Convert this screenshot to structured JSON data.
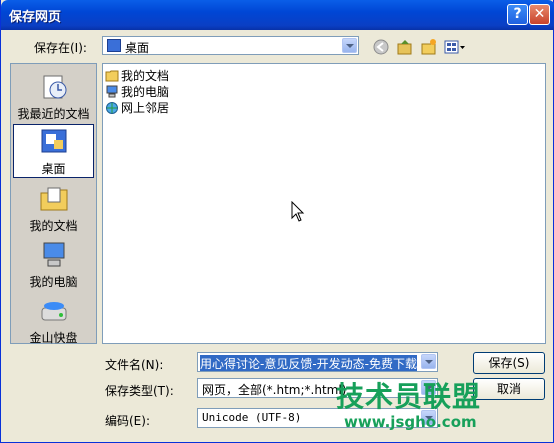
{
  "window": {
    "title": "保存网页",
    "help_glyph": "?",
    "close_glyph": "✕"
  },
  "toolbar": {
    "save_in_label": "保存在(I):",
    "save_in_value": "桌面"
  },
  "places": [
    {
      "label": "我最近的文档",
      "icon": "recent-documents-icon"
    },
    {
      "label": "桌面",
      "icon": "desktop-icon"
    },
    {
      "label": "我的文档",
      "icon": "my-documents-icon"
    },
    {
      "label": "我的电脑",
      "icon": "my-computer-icon"
    },
    {
      "label": "金山快盘",
      "icon": "drive-icon"
    }
  ],
  "files": [
    {
      "label": "我的文档",
      "icon": "folder-icon"
    },
    {
      "label": "我的电脑",
      "icon": "computer-icon"
    },
    {
      "label": "网上邻居",
      "icon": "network-icon"
    }
  ],
  "form": {
    "filename_label": "文件名(N):",
    "filename_value": "用心得讨论-意见反馈-开发动态-免费下载",
    "type_label": "保存类型(T):",
    "type_value": "网页，全部(*.htm;*.html)",
    "encoding_label": "编码(E):",
    "encoding_value": "Unicode (UTF-8)"
  },
  "buttons": {
    "save": "保存(S)",
    "cancel": "取消"
  },
  "watermark": {
    "title": "技术员联盟",
    "url": "www.jsgho.com"
  },
  "colors": {
    "titlebar": "#0a5ee8",
    "accent": "#316ac5",
    "watermark": "#17a05a"
  }
}
